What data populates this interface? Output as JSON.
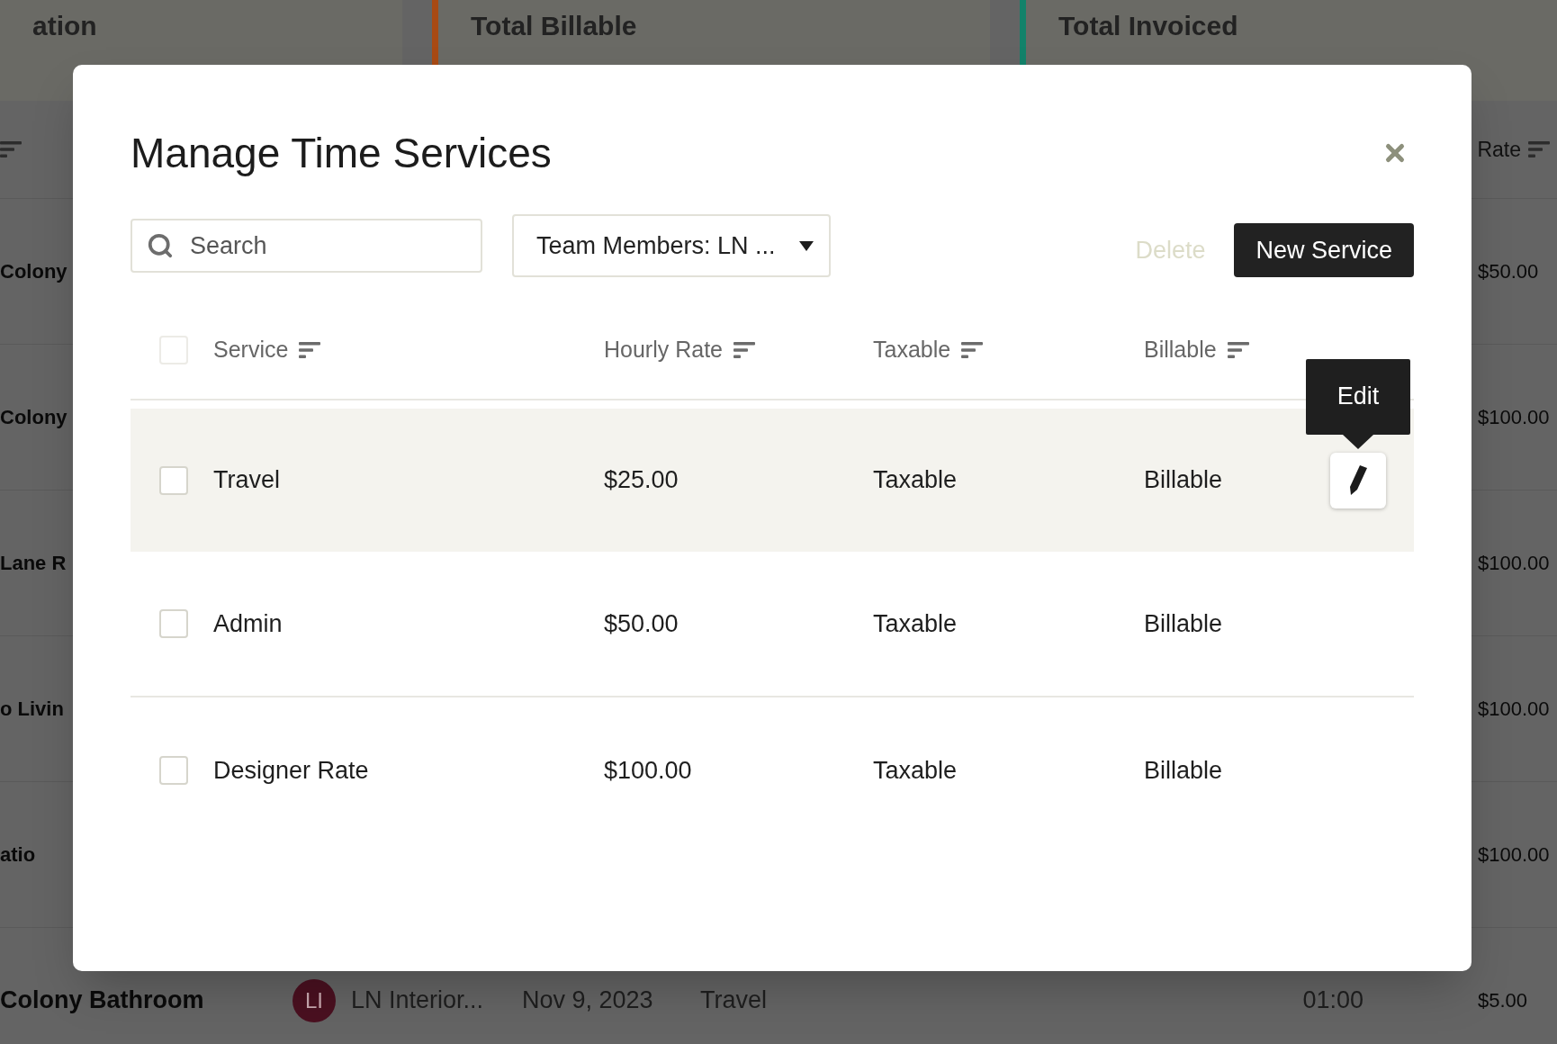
{
  "background_page": {
    "summary_cards": [
      {
        "label": "ation"
      },
      {
        "label": "Total Billable",
        "color": "#a84a14"
      },
      {
        "label": "Total Invoiced",
        "color": "#13826a"
      }
    ],
    "table": {
      "right_column": "Rate",
      "rows": [
        {
          "column_1": "Colony",
          "rate": "$50.00"
        },
        {
          "column_1": "Colony",
          "rate": "$100.00"
        },
        {
          "column_1": "Lane R",
          "rate": "$100.00"
        },
        {
          "column_1": "o Livin",
          "rate": "$100.00"
        },
        {
          "column_1": "atio",
          "rate": "$100.00"
        },
        {
          "column_1": "Colony Bathroom",
          "avatar": "LI",
          "member": "LN Interior...",
          "date": "Nov 9, 2023",
          "service": "Travel",
          "hours": "01:00",
          "rate": "$5.00"
        }
      ]
    }
  },
  "modal": {
    "title": "Manage Time Services",
    "search": {
      "placeholder": "Search"
    },
    "filter": {
      "value": "Team Members: LN ..."
    },
    "buttons": [
      {
        "label": "Delete",
        "kind": "text",
        "disabled": true
      },
      {
        "label": "New Service",
        "kind": "primary",
        "disabled": false
      }
    ],
    "table": {
      "select_all": {
        "checked": false
      },
      "columns": [
        "Service",
        "Hourly Rate",
        "Taxable",
        "Billable"
      ],
      "rows": [
        {
          "service": "Travel",
          "hourly_rate": "$25.00",
          "taxable": "Taxable",
          "billable": "Billable",
          "checked": false,
          "hovered": true
        },
        {
          "service": "Admin",
          "hourly_rate": "$50.00",
          "taxable": "Taxable",
          "billable": "Billable",
          "checked": false,
          "hovered": false
        },
        {
          "service": "Designer Rate",
          "hourly_rate": "$100.00",
          "taxable": "Taxable",
          "billable": "Billable",
          "checked": false,
          "hovered": false
        }
      ]
    },
    "tooltip": "Edit"
  }
}
